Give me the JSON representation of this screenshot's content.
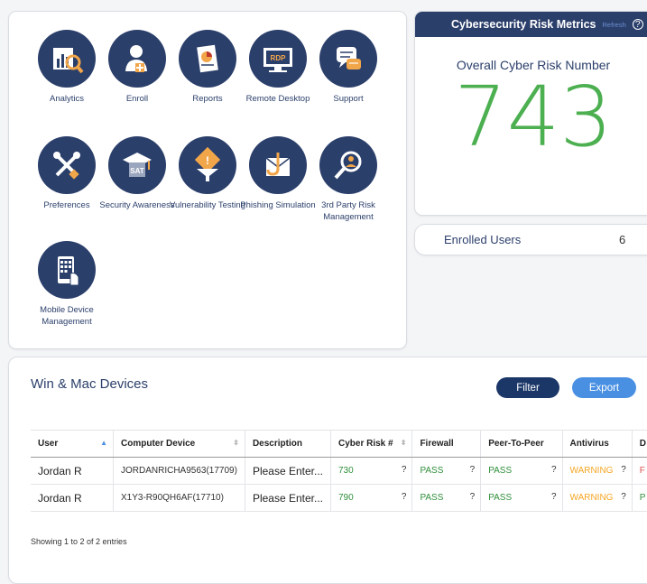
{
  "apps": [
    {
      "label": "Analytics",
      "icon": "analytics-icon"
    },
    {
      "label": "Enroll",
      "icon": "enroll-icon"
    },
    {
      "label": "Reports",
      "icon": "reports-icon"
    },
    {
      "label": "Remote Desktop",
      "icon": "remote-desktop-icon"
    },
    {
      "label": "Support",
      "icon": "support-icon"
    },
    {
      "label": "Preferences",
      "icon": "preferences-icon"
    },
    {
      "label": "Security Awareness",
      "icon": "security-awareness-icon"
    },
    {
      "label": "Vulnerability Testing",
      "icon": "vulnerability-testing-icon"
    },
    {
      "label": "Phishing Simulation",
      "icon": "phishing-simulation-icon"
    },
    {
      "label": "3rd Party Risk Management",
      "icon": "third-party-risk-icon"
    },
    {
      "label": "Mobile Device Management",
      "icon": "mobile-device-icon"
    }
  ],
  "metrics": {
    "title": "Cybersecurity Risk Metrics",
    "refresh": "Refresh",
    "subtitle": "Overall Cyber Risk Number",
    "value": "743"
  },
  "enrolled": {
    "label": "Enrolled Users",
    "value": "6"
  },
  "devices": {
    "title": "Win & Mac Devices",
    "filter": "Filter",
    "export": "Export",
    "columns": [
      "User",
      "Computer Device",
      "Description",
      "Cyber Risk #",
      "Firewall",
      "Peer-To-Peer",
      "Antivirus",
      "D"
    ],
    "rows": [
      {
        "user": "Jordan R",
        "device": "JORDANRICHA9563(17709)",
        "description": "Please Enter...",
        "risk": "730",
        "firewall": "PASS",
        "p2p": "PASS",
        "antivirus": "WARNING",
        "d": "F"
      },
      {
        "user": "Jordan R",
        "device": "X1Y3-R90QH6AF(17710)",
        "description": "Please Enter...",
        "risk": "790",
        "firewall": "PASS",
        "p2p": "PASS",
        "antivirus": "WARNING",
        "d": "P"
      }
    ],
    "info": "Showing 1 to 2 of 2 entries"
  },
  "colors": {
    "navy": "#2b3f6b",
    "green": "#4caf50",
    "blue": "#4a90e2",
    "warning": "#f5a623"
  }
}
